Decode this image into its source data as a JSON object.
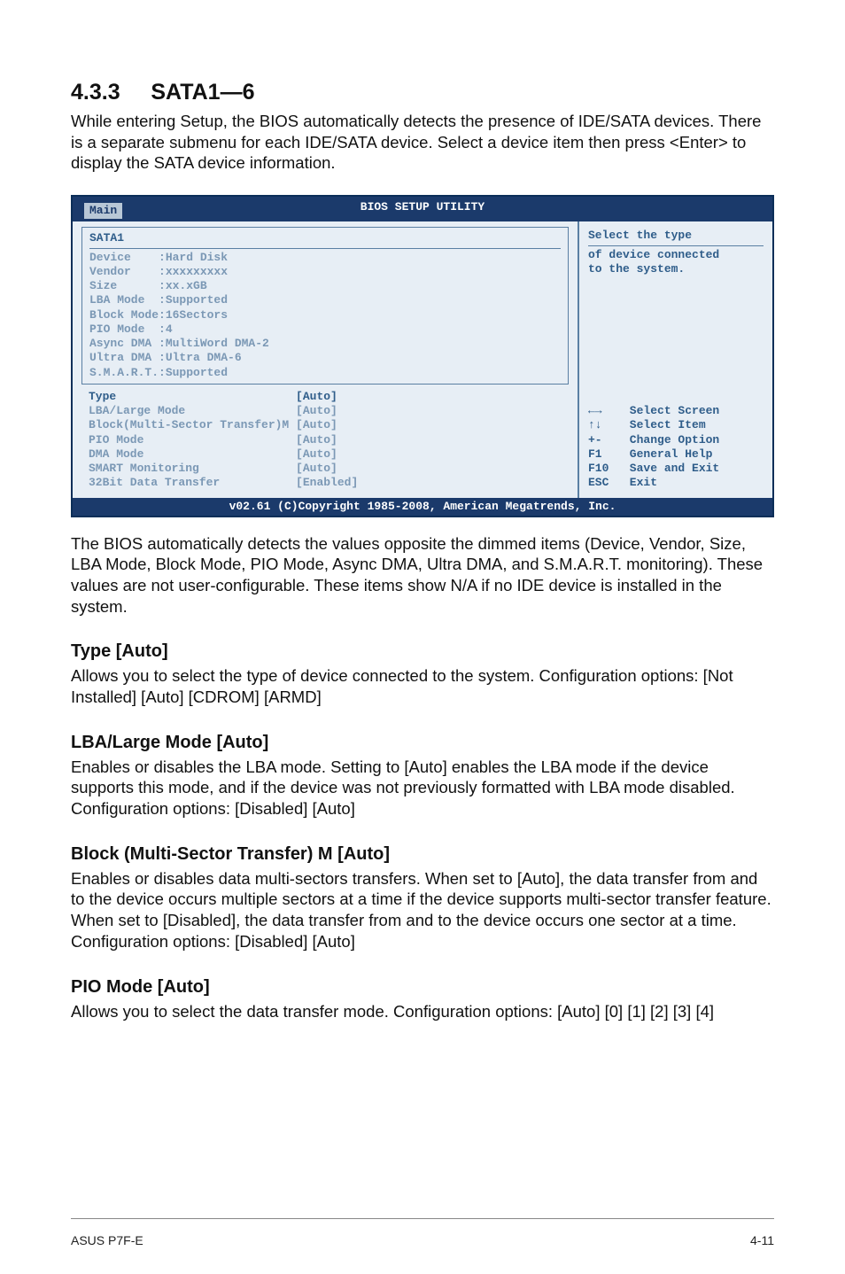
{
  "section": {
    "number": "4.3.3",
    "title": "SATA1—6",
    "intro": "While entering Setup, the BIOS automatically detects the presence of IDE/SATA devices. There is a separate submenu for each IDE/SATA device. Select a device item then press <Enter> to display the SATA device information."
  },
  "bios": {
    "utility_title": "BIOS SETUP UTILITY",
    "tab": "Main",
    "panel_title": "SATA1",
    "info_rows": [
      "Device    :Hard Disk",
      "Vendor    :xxxxxxxxx",
      "Size      :xx.xGB",
      "LBA Mode  :Supported",
      "Block Mode:16Sectors",
      "PIO Mode  :4",
      "Async DMA :MultiWord DMA-2",
      "Ultra DMA :Ultra DMA-6",
      "S.M.A.R.T.:Supported"
    ],
    "setting_rows": [
      "Type                          [Auto]",
      "LBA/Large Mode                [Auto]",
      "Block(Multi-Sector Transfer)M [Auto]",
      "PIO Mode                      [Auto]",
      "DMA Mode                      [Auto]",
      "SMART Monitoring              [Auto]",
      "32Bit Data Transfer           [Enabled]"
    ],
    "help": {
      "l1": "Select the type",
      "l2": "of device connected",
      "l3": "to the system."
    },
    "legend": [
      "←→    Select Screen",
      "↑↓    Select Item",
      "+-    Change Option",
      "F1    General Help",
      "F10   Save and Exit",
      "ESC   Exit"
    ],
    "copyright": "v02.61 (C)Copyright 1985-2008, American Megatrends, Inc."
  },
  "after_bios": "The BIOS automatically detects the values opposite the dimmed items (Device, Vendor, Size, LBA Mode, Block Mode, PIO Mode, Async DMA, Ultra DMA, and S.M.A.R.T. monitoring). These values are not user-configurable. These items show N/A if no IDE device is installed in the system.",
  "subs": {
    "type": {
      "h": "Type [Auto]",
      "p": "Allows you to select the type of device connected to the system. Configuration options: [Not Installed] [Auto] [CDROM] [ARMD]"
    },
    "lba": {
      "h": "LBA/Large Mode [Auto]",
      "p": "Enables or disables the LBA mode. Setting to [Auto] enables the LBA mode if the device supports this mode, and if the device was not previously formatted with LBA mode disabled. Configuration options: [Disabled] [Auto]"
    },
    "block": {
      "h": "Block (Multi-Sector Transfer) M [Auto]",
      "p": "Enables or disables data multi-sectors transfers. When set to [Auto], the data transfer from and to the device occurs multiple sectors at a time if the device supports multi-sector transfer feature. When set to [Disabled], the data transfer from and to the device occurs one sector at a time. Configuration options: [Disabled] [Auto]"
    },
    "pio": {
      "h": "PIO Mode [Auto]",
      "p": "Allows you to select the data transfer mode. Configuration options: [Auto] [0] [1] [2] [3] [4]"
    }
  },
  "footer": {
    "left": "ASUS P7F-E",
    "right": "4-11"
  }
}
